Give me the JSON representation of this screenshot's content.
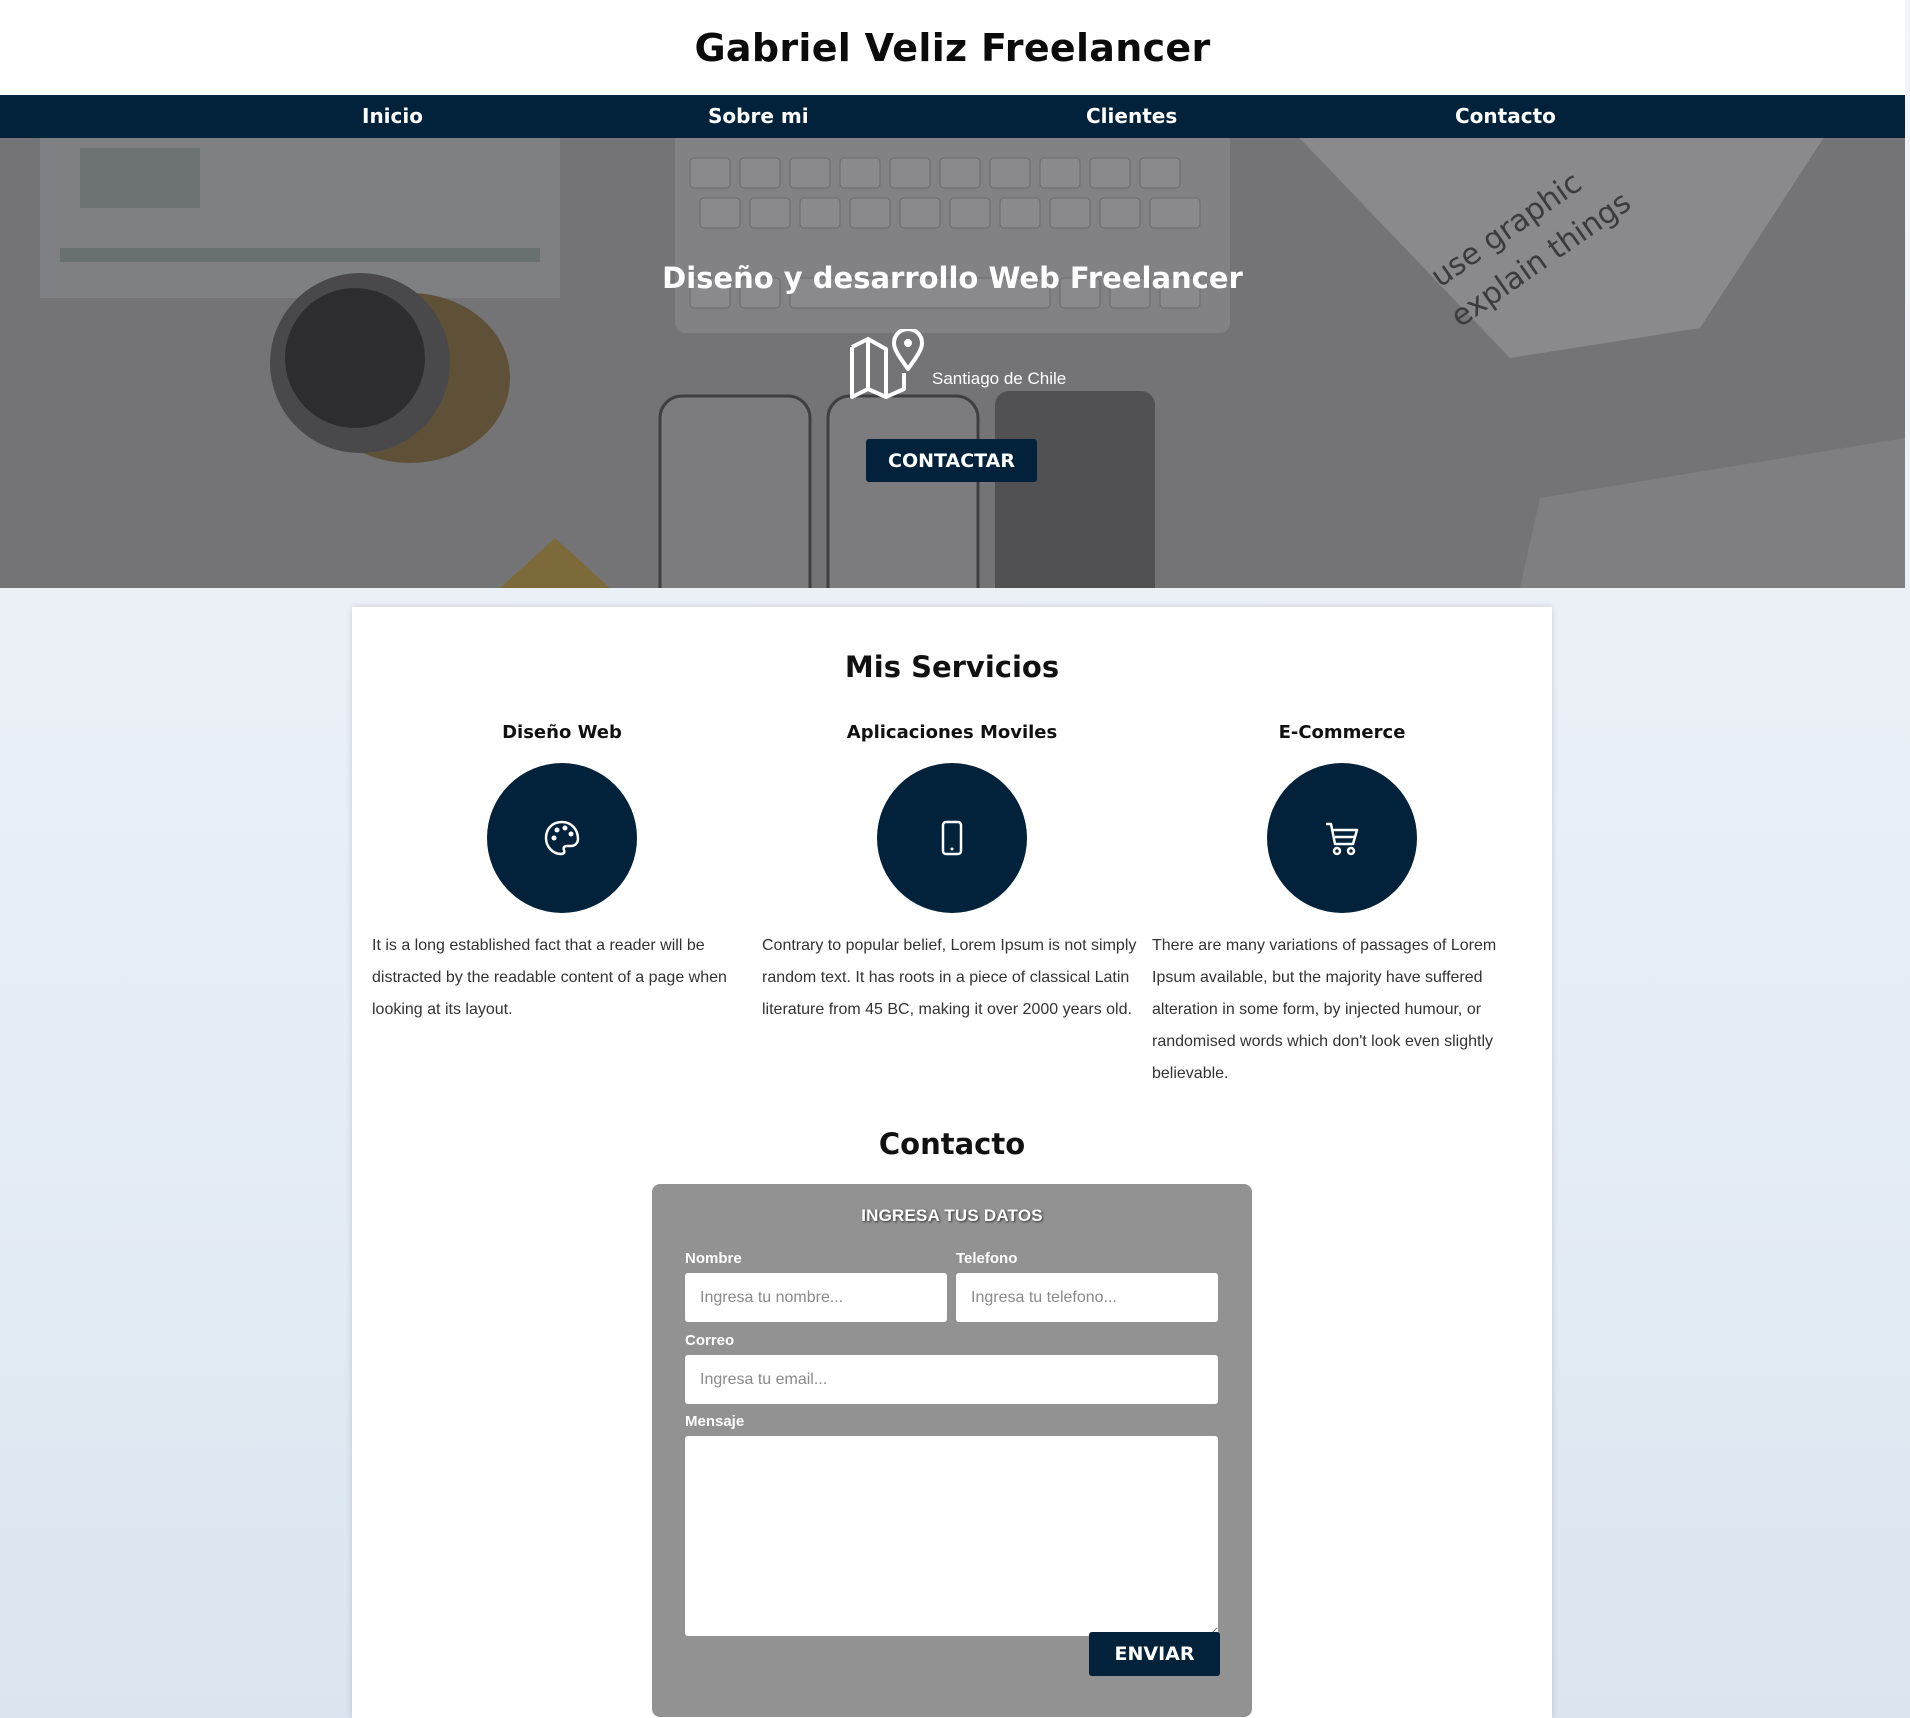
{
  "site": {
    "title": "Gabriel Veliz Freelancer"
  },
  "nav": {
    "items": [
      "Inicio",
      "Sobre mi",
      "Clientes",
      "Contacto"
    ]
  },
  "hero": {
    "title": "Diseño y desarrollo Web Freelancer",
    "location": "Santiago de Chile",
    "location_icon": "map-pin-icon",
    "cta_label": "CONTACTAR"
  },
  "services": {
    "title": "Mis Servicios",
    "items": [
      {
        "title": "Diseño Web",
        "icon": "palette-icon",
        "text": "It is a long established fact that a reader will be distracted by the readable content of a page when looking at its layout."
      },
      {
        "title": "Aplicaciones Moviles",
        "icon": "mobile-icon",
        "text": "Contrary to popular belief, Lorem Ipsum is not simply random text. It has roots in a piece of classical Latin literature from 45 BC, making it over 2000 years old."
      },
      {
        "title": "E-Commerce",
        "icon": "cart-icon",
        "text": "There are many variations of passages of Lorem Ipsum available, but the majority have suffered alteration in some form, by injected humour, or randomised words which don't look even slightly believable."
      }
    ]
  },
  "contact": {
    "title": "Contacto",
    "form_heading": "INGRESA TUS DATOS",
    "name_label": "Nombre",
    "name_placeholder": "Ingresa tu nombre...",
    "phone_label": "Telefono",
    "phone_placeholder": "Ingresa tu telefono...",
    "email_label": "Correo",
    "email_placeholder": "Ingresa tu email...",
    "message_label": "Mensaje",
    "message_placeholder": "",
    "submit_label": "ENVIAR"
  },
  "colors": {
    "primary": "#02213a",
    "form_bg": "#929292",
    "page_bg": "#e6edf5"
  }
}
